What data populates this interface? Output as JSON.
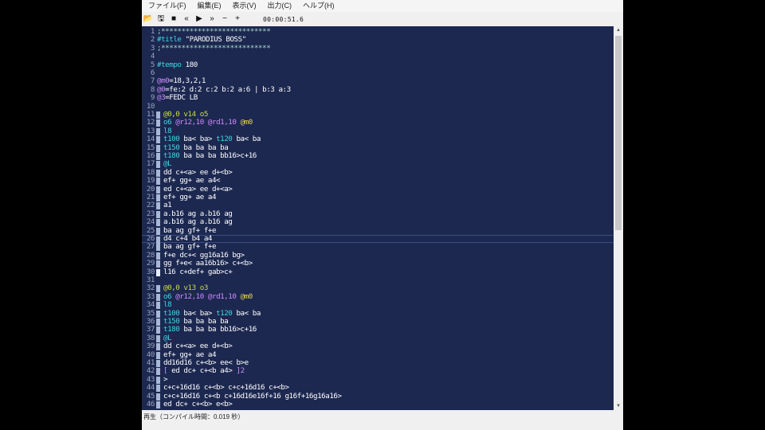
{
  "window": {
    "menus": [
      "ファイル(F)",
      "編集(E)",
      "表示(V)",
      "出力(C)",
      "ヘルプ(H)"
    ],
    "toolbar": {
      "buttons": [
        {
          "name": "open",
          "glyph": "📂"
        },
        {
          "name": "save",
          "glyph": "🖫"
        },
        {
          "name": "stop",
          "glyph": "■"
        },
        {
          "name": "rewind",
          "glyph": "«"
        },
        {
          "name": "play",
          "glyph": "▶"
        },
        {
          "name": "fast-forward",
          "glyph": "»"
        },
        {
          "name": "minus",
          "glyph": "−"
        },
        {
          "name": "plus",
          "glyph": "+"
        }
      ],
      "time": "00:00:51.6"
    },
    "status": "再生（コンパイル時間：0.019 秒）"
  },
  "editor": {
    "colors": {
      "background": "#1c2850",
      "text": "#ffffff",
      "keyword": "#3fd6e0",
      "macro": "#d08aff",
      "channel_header": "#c9dc4a",
      "comment_star": "#a8d8c8"
    },
    "current_line": 26,
    "lines": [
      {
        "n": "1",
        "mark": "",
        "seg": [
          [
            "s",
            ";***************************"
          ]
        ]
      },
      {
        "n": "2",
        "mark": "",
        "seg": [
          [
            "k",
            "#title"
          ],
          [
            "w",
            " \"PARODIUS BOSS\""
          ]
        ]
      },
      {
        "n": "3",
        "mark": "",
        "seg": [
          [
            "s",
            ";***************************"
          ]
        ]
      },
      {
        "n": "4",
        "mark": "",
        "seg": []
      },
      {
        "n": "5",
        "mark": "",
        "seg": [
          [
            "k",
            "#tempo"
          ],
          [
            "w",
            " 180"
          ]
        ]
      },
      {
        "n": "6",
        "mark": "",
        "seg": []
      },
      {
        "n": "7",
        "mark": "",
        "seg": [
          [
            "m",
            "@m0"
          ],
          [
            "w",
            "=18,3,2,1"
          ]
        ]
      },
      {
        "n": "8",
        "mark": "",
        "seg": [
          [
            "m",
            "@0"
          ],
          [
            "w",
            "=fe:2 d:2 c:2 b:2 a:6 | b:3 a:3"
          ]
        ]
      },
      {
        "n": "9",
        "mark": "",
        "seg": [
          [
            "m",
            "@3"
          ],
          [
            "w",
            "=FEDC LB"
          ]
        ]
      },
      {
        "n": "10",
        "mark": "",
        "seg": []
      },
      {
        "n": "11",
        "mark": "pale",
        "seg": [
          [
            "g",
            "@0,0 v14 o5"
          ]
        ]
      },
      {
        "n": "12",
        "mark": "pale",
        "seg": [
          [
            "k",
            "o6 "
          ],
          [
            "m",
            "@r12,10 @rd1,10 "
          ],
          [
            "y",
            "@m0"
          ]
        ]
      },
      {
        "n": "13",
        "mark": "pale",
        "seg": [
          [
            "k",
            "l8"
          ]
        ]
      },
      {
        "n": "14",
        "mark": "pale",
        "seg": [
          [
            "k",
            "t100"
          ],
          [
            "w",
            " ba< ba> "
          ],
          [
            "k",
            "t120"
          ],
          [
            "w",
            " ba< ba"
          ]
        ]
      },
      {
        "n": "15",
        "mark": "pale",
        "seg": [
          [
            "k",
            "t150"
          ],
          [
            "w",
            " ba ba ba ba"
          ]
        ]
      },
      {
        "n": "16",
        "mark": "pale",
        "seg": [
          [
            "k",
            "t180"
          ],
          [
            "w",
            " ba ba ba bb16>c+16"
          ]
        ]
      },
      {
        "n": "17",
        "mark": "pale",
        "seg": [
          [
            "k",
            "@L"
          ]
        ]
      },
      {
        "n": "18",
        "mark": "pale",
        "seg": [
          [
            "w",
            "dd c+<a> ee d+<b>"
          ]
        ]
      },
      {
        "n": "19",
        "mark": "pale",
        "seg": [
          [
            "w",
            "ef+ gg+ ae a4<"
          ]
        ]
      },
      {
        "n": "20",
        "mark": "pale",
        "seg": [
          [
            "w",
            "ed c+<a> ee d+<a>"
          ]
        ]
      },
      {
        "n": "21",
        "mark": "pale",
        "seg": [
          [
            "w",
            "ef+ gg+ ae a4"
          ]
        ]
      },
      {
        "n": "22",
        "mark": "pale",
        "seg": [
          [
            "w",
            "a1"
          ]
        ]
      },
      {
        "n": "23",
        "mark": "pale",
        "seg": [
          [
            "w",
            "a.b16 ag a.b16 ag"
          ]
        ]
      },
      {
        "n": "24",
        "mark": "pale",
        "seg": [
          [
            "w",
            "a.b16 ag a.b16 ag"
          ]
        ]
      },
      {
        "n": "25",
        "mark": "pale",
        "seg": [
          [
            "w",
            "ba ag gf+ f+e"
          ]
        ]
      },
      {
        "n": "26",
        "mark": "pale",
        "seg": [
          [
            "w",
            "d4 c+4 b4 a4"
          ]
        ]
      },
      {
        "n": "27",
        "mark": "pale",
        "seg": [
          [
            "w",
            "ba ag gf+ f+e"
          ]
        ]
      },
      {
        "n": "28",
        "mark": "pale",
        "seg": [
          [
            "w",
            "f+e dc+< gg16a16 bg>"
          ]
        ]
      },
      {
        "n": "29",
        "mark": "pale",
        "seg": [
          [
            "w",
            "gg f+e< aa16b16> c+<b>"
          ]
        ]
      },
      {
        "n": "30",
        "mark": "bright",
        "seg": [
          [
            "w",
            "l16 c+def+ gab>c+"
          ]
        ]
      },
      {
        "n": "31",
        "mark": "",
        "seg": []
      },
      {
        "n": "32",
        "mark": "pale",
        "seg": [
          [
            "g",
            "@0,0 v13 o3"
          ]
        ]
      },
      {
        "n": "33",
        "mark": "pale",
        "seg": [
          [
            "k",
            "o6 "
          ],
          [
            "m",
            "@r12,10 @rd1,10 "
          ],
          [
            "y",
            "@m0"
          ]
        ]
      },
      {
        "n": "34",
        "mark": "pale",
        "seg": [
          [
            "k",
            "l8"
          ]
        ]
      },
      {
        "n": "35",
        "mark": "pale",
        "seg": [
          [
            "k",
            "t100"
          ],
          [
            "w",
            " ba< ba> "
          ],
          [
            "k",
            "t120"
          ],
          [
            "w",
            " ba< ba"
          ]
        ]
      },
      {
        "n": "36",
        "mark": "pale",
        "seg": [
          [
            "k",
            "t150"
          ],
          [
            "w",
            " ba ba ba ba"
          ]
        ]
      },
      {
        "n": "37",
        "mark": "pale",
        "seg": [
          [
            "k",
            "t180"
          ],
          [
            "w",
            " ba ba ba bb16>c+16"
          ]
        ]
      },
      {
        "n": "38",
        "mark": "pale",
        "seg": [
          [
            "k",
            "@L"
          ]
        ]
      },
      {
        "n": "39",
        "mark": "pale",
        "seg": [
          [
            "w",
            "dd c+<a> ee d+<b>"
          ]
        ]
      },
      {
        "n": "40",
        "mark": "pale",
        "seg": [
          [
            "w",
            "ef+ gg+ ae a4"
          ]
        ]
      },
      {
        "n": "41",
        "mark": "pale",
        "seg": [
          [
            "w",
            "dd16d16 c+<b> ee< b>e"
          ]
        ]
      },
      {
        "n": "42",
        "mark": "pale",
        "seg": [
          [
            "m",
            "["
          ],
          [
            "w",
            " ed dc+ c+<b a4> "
          ],
          [
            "m",
            "]2"
          ]
        ]
      },
      {
        "n": "43",
        "mark": "pale",
        "seg": [
          [
            "w",
            ">"
          ]
        ]
      },
      {
        "n": "44",
        "mark": "pale",
        "seg": [
          [
            "w",
            "c+c+16d16 c+<b> c+c+16d16 c+<b>"
          ]
        ]
      },
      {
        "n": "45",
        "mark": "pale",
        "seg": [
          [
            "w",
            "c+c+16d16 c+<b c+16d16e16f+16 g16f+16g16a16>"
          ]
        ]
      },
      {
        "n": "46",
        "mark": "pale",
        "seg": [
          [
            "w",
            "ed dc+ c+<b> e<b>"
          ]
        ]
      }
    ]
  }
}
